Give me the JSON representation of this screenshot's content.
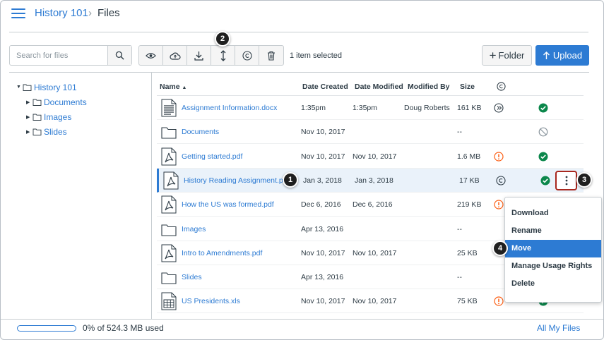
{
  "breadcrumb": {
    "course": "History 101",
    "separator": "›",
    "page": "Files"
  },
  "toolbar": {
    "search_placeholder": "Search for files",
    "tools": [
      "eye-icon",
      "cloud-icon",
      "download-icon",
      "move-icon",
      "copyright-icon",
      "trash-icon"
    ],
    "selection_text": "1 item selected",
    "folder_button": "Folder",
    "upload_button": "Upload"
  },
  "tree": {
    "root": "History 101",
    "folders": [
      "Documents",
      "Images",
      "Slides"
    ]
  },
  "table": {
    "headers": {
      "name": "Name",
      "sort_indicator": "▲",
      "created": "Date Created",
      "modified": "Date Modified",
      "modified_by": "Modified By",
      "size": "Size"
    },
    "rows": [
      {
        "name": "Assignment Information.docx",
        "type": "doc",
        "created": "1:35pm",
        "modified": "1:35pm",
        "modified_by": "Doug Roberts",
        "size": "161 KB",
        "sync": "clock",
        "status": "published"
      },
      {
        "name": "Documents",
        "type": "folder",
        "created": "Nov 10, 2017",
        "modified": "",
        "modified_by": "",
        "size": "--",
        "sync": "",
        "status": "unpublished"
      },
      {
        "name": "Getting started.pdf",
        "type": "pdf",
        "created": "Nov 10, 2017",
        "modified": "Nov 10, 2017",
        "modified_by": "",
        "size": "1.6 MB",
        "sync": "warning",
        "status": "published"
      },
      {
        "name": "History Reading Assignment.pdf",
        "type": "pdf",
        "created": "Jan 3, 2018",
        "modified": "Jan 3, 2018",
        "modified_by": "",
        "size": "17 KB",
        "sync": "copyright",
        "status": "published",
        "selected": true
      },
      {
        "name": "How the US was formed.pdf",
        "type": "pdf",
        "created": "Dec 6, 2016",
        "modified": "Dec 6, 2016",
        "modified_by": "",
        "size": "219 KB",
        "sync": "warning",
        "status": ""
      },
      {
        "name": "Images",
        "type": "folder",
        "created": "Apr 13, 2016",
        "modified": "",
        "modified_by": "",
        "size": "--",
        "sync": "",
        "status": ""
      },
      {
        "name": "Intro to Amendments.pdf",
        "type": "pdf",
        "created": "Nov 10, 2017",
        "modified": "Nov 10, 2017",
        "modified_by": "",
        "size": "25 KB",
        "sync": "",
        "status": ""
      },
      {
        "name": "Slides",
        "type": "folder",
        "created": "Apr 13, 2016",
        "modified": "",
        "modified_by": "",
        "size": "--",
        "sync": "",
        "status": ""
      },
      {
        "name": "US Presidents.xls",
        "type": "xls",
        "created": "Nov 10, 2017",
        "modified": "Nov 10, 2017",
        "modified_by": "",
        "size": "75 KB",
        "sync": "warning",
        "status": "published"
      }
    ]
  },
  "menu": {
    "items": [
      "Download",
      "Rename",
      "Move",
      "Manage Usage Rights",
      "Delete"
    ],
    "active": "Move"
  },
  "callouts": [
    "1",
    "2",
    "3",
    "4"
  ],
  "footer": {
    "usage": "0% of 524.3 MB used",
    "usage_fraction": 0.0,
    "all_files": "All My Files"
  },
  "colors": {
    "accent": "#2d7bd3",
    "success": "#0b874b",
    "warning": "#fc5e13",
    "highlight": "#a8271e"
  }
}
